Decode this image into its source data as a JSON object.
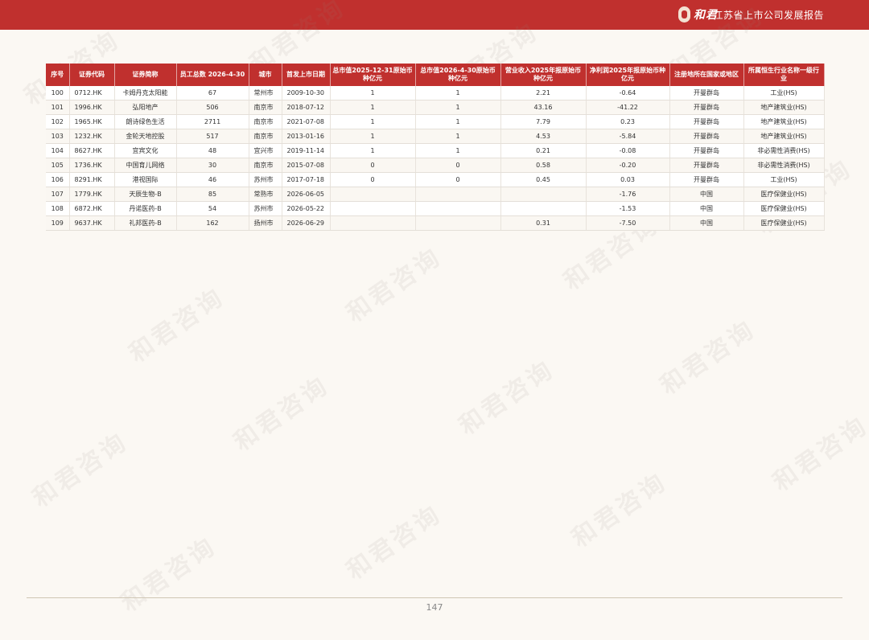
{
  "header": {
    "logo_text": "和君",
    "report_title": "江苏省上市公司发展报告"
  },
  "table": {
    "columns": [
      "序号",
      "证券代码",
      "证券简称",
      "员工总数 2026-4-30",
      "城市",
      "首发上市日期",
      "总市值2025-12-31原始币种亿元",
      "总市值2026-4-30原始币种亿元",
      "营业收入2025年报原始币种亿元",
      "净利润2025年报原始币种亿元",
      "注册地所在国家或地区",
      "所属恒生行业名称一级行业"
    ],
    "rows": [
      [
        "100",
        "0712.HK",
        "卡姆丹克太阳能",
        "67",
        "常州市",
        "2009-10-30",
        "1",
        "1",
        "2.21",
        "-0.64",
        "开曼群岛",
        "工业(HS)"
      ],
      [
        "101",
        "1996.HK",
        "弘阳地产",
        "506",
        "南京市",
        "2018-07-12",
        "1",
        "1",
        "43.16",
        "-41.22",
        "开曼群岛",
        "地产建筑业(HS)"
      ],
      [
        "102",
        "1965.HK",
        "朗诗绿色生活",
        "2711",
        "南京市",
        "2021-07-08",
        "1",
        "1",
        "7.79",
        "0.23",
        "开曼群岛",
        "地产建筑业(HS)"
      ],
      [
        "103",
        "1232.HK",
        "金轮天地控股",
        "517",
        "南京市",
        "2013-01-16",
        "1",
        "1",
        "4.53",
        "-5.84",
        "开曼群岛",
        "地产建筑业(HS)"
      ],
      [
        "104",
        "8627.HK",
        "宜宾文化",
        "48",
        "宜兴市",
        "2019-11-14",
        "1",
        "1",
        "0.21",
        "-0.08",
        "开曼群岛",
        "非必需性消费(HS)"
      ],
      [
        "105",
        "1736.HK",
        "中国育儿网络",
        "30",
        "南京市",
        "2015-07-08",
        "0",
        "0",
        "0.58",
        "-0.20",
        "开曼群岛",
        "非必需性消费(HS)"
      ],
      [
        "106",
        "8291.HK",
        "港视国际",
        "46",
        "苏州市",
        "2017-07-18",
        "0",
        "0",
        "0.45",
        "0.03",
        "开曼群岛",
        "工业(HS)"
      ],
      [
        "107",
        "1779.HK",
        "天辰生物-B",
        "85",
        "常熟市",
        "2026-06-05",
        "",
        "",
        "",
        "-1.76",
        "中国",
        "医疗保健业(HS)"
      ],
      [
        "108",
        "6872.HK",
        "丹诺医药-B",
        "54",
        "苏州市",
        "2026-05-22",
        "",
        "",
        "",
        "-1.53",
        "中国",
        "医疗保健业(HS)"
      ],
      [
        "109",
        "9637.HK",
        "礼邦医药-B",
        "162",
        "扬州市",
        "2026-06-29",
        "",
        "",
        "0.31",
        "-7.50",
        "中国",
        "医疗保健业(HS)"
      ]
    ]
  },
  "footer": {
    "page_number": "147"
  },
  "watermark_text": "和君咨询",
  "colors": {
    "brand_red": "#c0302e",
    "page_background": "#fbf8f3"
  }
}
